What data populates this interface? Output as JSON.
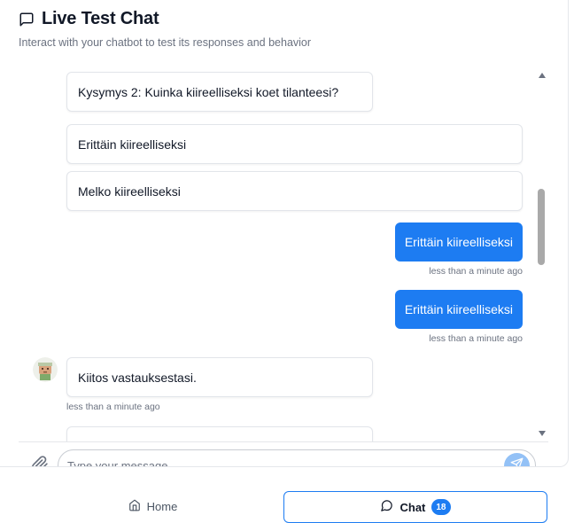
{
  "header": {
    "title": "Live Test Chat",
    "subtitle": "Interact with your chatbot to test its responses and behavior"
  },
  "messages": {
    "question": "Kysymys 2: Kuinka kiireelliseksi koet tilanteesi?",
    "option_1": "Erittäin kiireelliseksi",
    "option_2": "Melko kiireelliseksi",
    "user_1": "Erittäin kiireelliseksi",
    "user_1_time": "less than a minute ago",
    "user_2": "Erittäin kiireelliseksi",
    "user_2_time": "less than a minute ago",
    "bot_reply": "Kiitos vastauksestasi.",
    "bot_reply_time": "less than a minute ago"
  },
  "composer": {
    "placeholder": "Type your message..."
  },
  "nav": {
    "home_label": "Home",
    "chat_label": "Chat",
    "chat_badge": "18"
  },
  "colors": {
    "accent": "#1d7cf2",
    "send_disabled": "#93c1f6"
  },
  "icons": {
    "title": "message-square-icon",
    "attach": "paperclip-icon",
    "send": "send-icon",
    "home": "home-icon",
    "chat": "message-circle-icon"
  }
}
